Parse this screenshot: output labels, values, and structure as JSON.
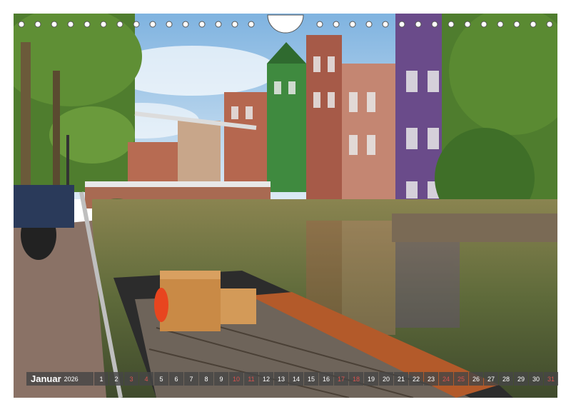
{
  "calendar": {
    "month": "Januar",
    "year": "2026",
    "days": [
      {
        "n": "1",
        "weekend": false
      },
      {
        "n": "2",
        "weekend": false
      },
      {
        "n": "3",
        "weekend": true
      },
      {
        "n": "4",
        "weekend": true
      },
      {
        "n": "5",
        "weekend": false
      },
      {
        "n": "6",
        "weekend": false
      },
      {
        "n": "7",
        "weekend": false
      },
      {
        "n": "8",
        "weekend": false
      },
      {
        "n": "9",
        "weekend": false
      },
      {
        "n": "10",
        "weekend": true
      },
      {
        "n": "11",
        "weekend": true
      },
      {
        "n": "12",
        "weekend": false
      },
      {
        "n": "13",
        "weekend": false
      },
      {
        "n": "14",
        "weekend": false
      },
      {
        "n": "15",
        "weekend": false
      },
      {
        "n": "16",
        "weekend": false
      },
      {
        "n": "17",
        "weekend": true
      },
      {
        "n": "18",
        "weekend": true
      },
      {
        "n": "19",
        "weekend": false
      },
      {
        "n": "20",
        "weekend": false
      },
      {
        "n": "21",
        "weekend": false
      },
      {
        "n": "22",
        "weekend": false
      },
      {
        "n": "23",
        "weekend": false
      },
      {
        "n": "24",
        "weekend": true
      },
      {
        "n": "25",
        "weekend": true
      },
      {
        "n": "26",
        "weekend": false
      },
      {
        "n": "27",
        "weekend": false
      },
      {
        "n": "28",
        "weekend": false
      },
      {
        "n": "29",
        "weekend": false
      },
      {
        "n": "30",
        "weekend": false
      },
      {
        "n": "31",
        "weekend": true
      }
    ],
    "weekend_color": "#d9534f"
  },
  "photo": {
    "sky": "#a9cde8",
    "water": "#6b6a3a",
    "boat": "#2c2c2c"
  }
}
